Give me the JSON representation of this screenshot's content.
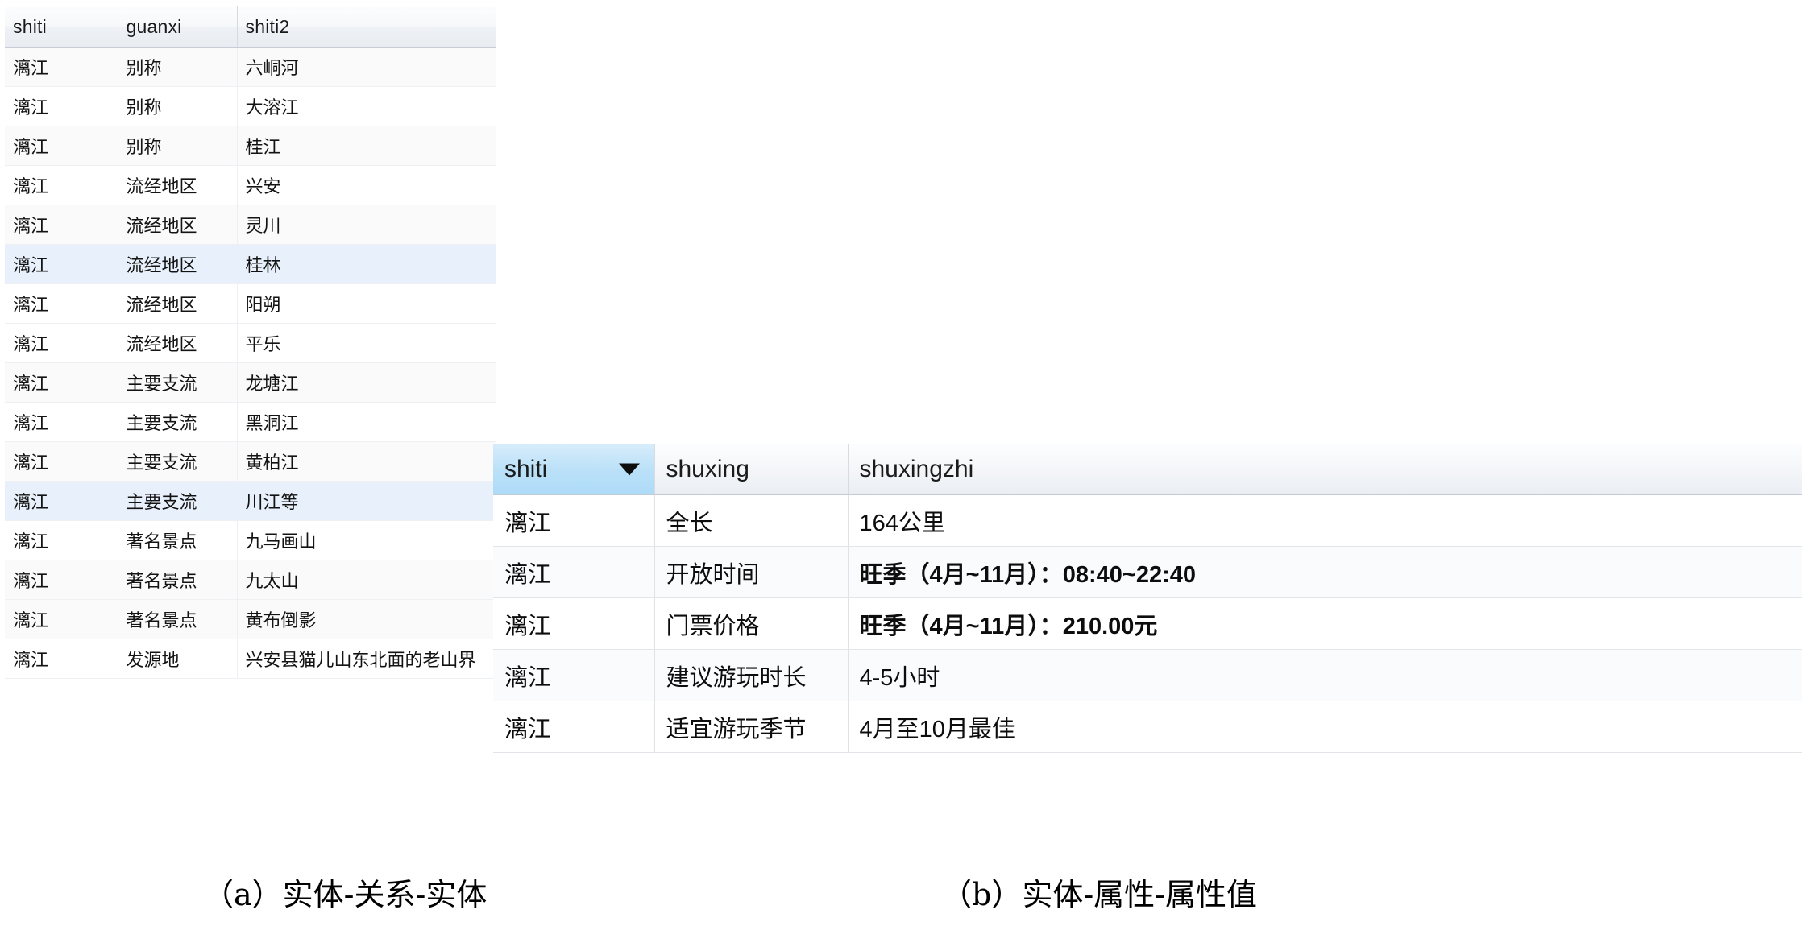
{
  "figure": {
    "caption_a": "（a）实体-关系-实体",
    "caption_b": "（b）实体-属性-属性值"
  },
  "table_a": {
    "name": "entity-relation-entity-table",
    "columns": [
      "shiti",
      "guanxi",
      "shiti2"
    ],
    "rows": [
      [
        "漓江",
        "别称",
        "六峒河"
      ],
      [
        "漓江",
        "别称",
        "大溶江"
      ],
      [
        "漓江",
        "别称",
        "桂江"
      ],
      [
        "漓江",
        "流经地区",
        "兴安"
      ],
      [
        "漓江",
        "流经地区",
        "灵川"
      ],
      [
        "漓江",
        "流经地区",
        "桂林"
      ],
      [
        "漓江",
        "流经地区",
        "阳朔"
      ],
      [
        "漓江",
        "流经地区",
        "平乐"
      ],
      [
        "漓江",
        "主要支流",
        "龙塘江"
      ],
      [
        "漓江",
        "主要支流",
        "黑洞江"
      ],
      [
        "漓江",
        "主要支流",
        "黄柏江"
      ],
      [
        "漓江",
        "主要支流",
        "川江等"
      ],
      [
        "漓江",
        "著名景点",
        "九马画山"
      ],
      [
        "漓江",
        "著名景点",
        "九太山"
      ],
      [
        "漓江",
        "著名景点",
        "黄布倒影"
      ],
      [
        "漓江",
        "发源地",
        "兴安县猫儿山东北面的老山界"
      ]
    ],
    "selected_row_indices": [
      5,
      11
    ],
    "alt_row_indices": [
      0,
      2,
      4,
      6,
      8,
      10,
      12,
      14
    ]
  },
  "table_b": {
    "name": "entity-attribute-value-table",
    "columns": [
      "shiti",
      "shuxing",
      "shuxingzhi"
    ],
    "sorted_column": "shiti",
    "sort_icon": "chevron-down-icon",
    "rows": [
      [
        "漓江",
        "全长",
        "164公里"
      ],
      [
        "漓江",
        "开放时间",
        "旺季（4月~11月）：08:40~22:40"
      ],
      [
        "漓江",
        "门票价格",
        "旺季（4月~11月）：210.00元"
      ],
      [
        "漓江",
        "建议游玩时长",
        "4-5小时"
      ],
      [
        "漓江",
        "适宜游玩季节",
        "4月至10月最佳"
      ]
    ],
    "bold_value_indices": [
      1,
      2
    ],
    "alt_row_indices": [
      1,
      3
    ]
  },
  "colors": {
    "header_gradient_top": "#fcfdfe",
    "header_gradient_bottom": "#e9edf2",
    "sorted_header": "#b9e0f8",
    "selected_row": "#e8f1fb",
    "alt_row": "#fafafa",
    "grid_line": "#e2e6eb",
    "text": "#101010"
  }
}
